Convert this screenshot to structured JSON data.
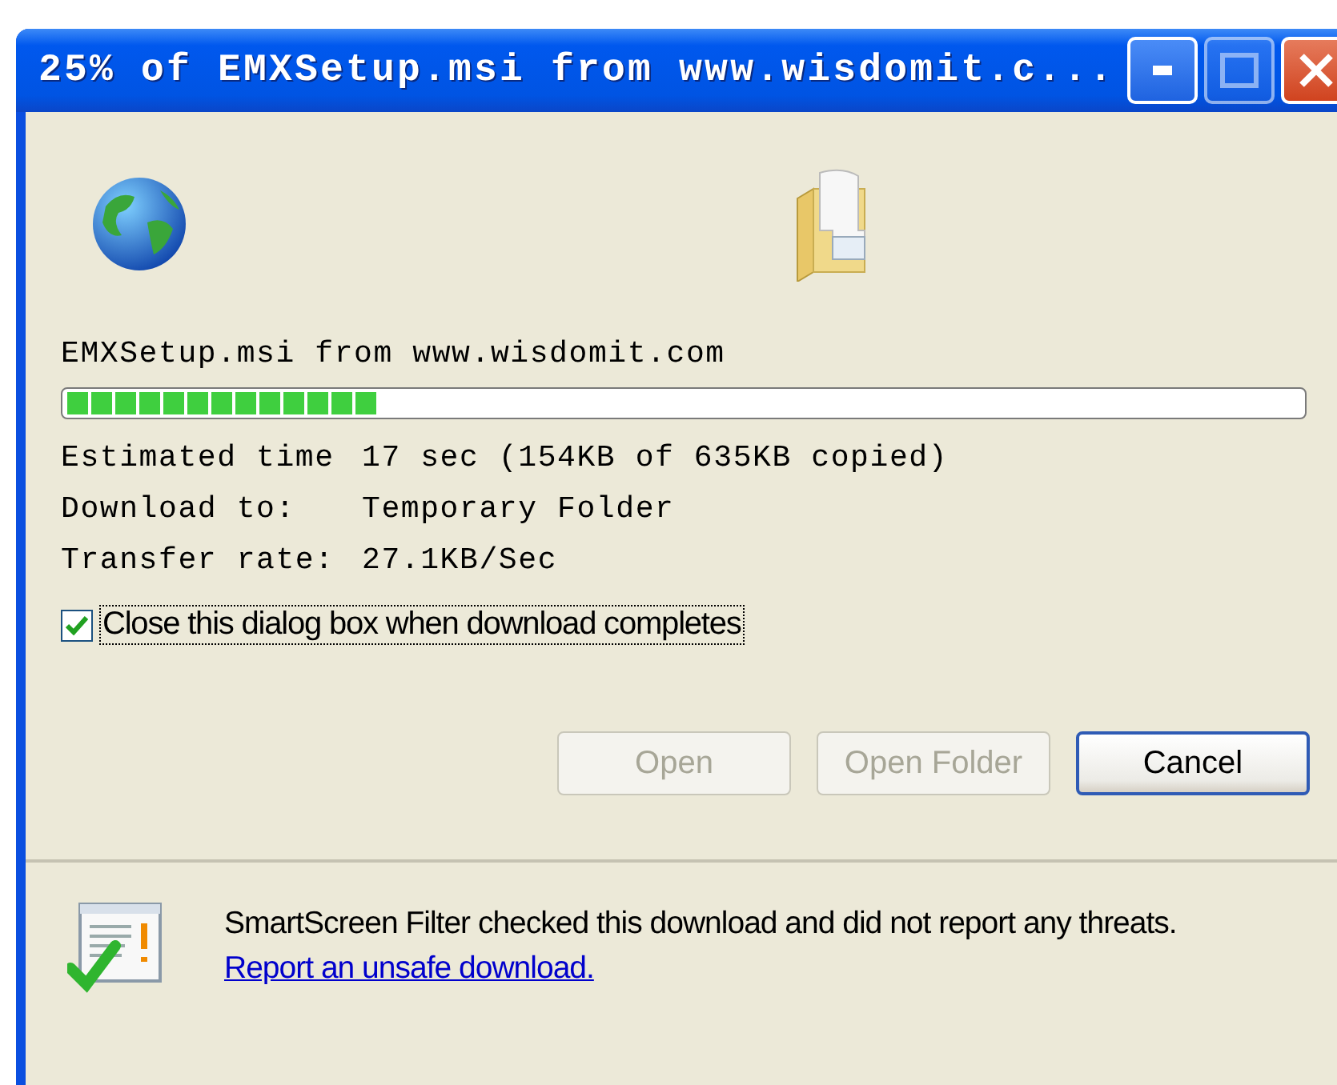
{
  "window": {
    "title": "25% of EMXSetup.msi from www.wisdomit.c...",
    "controls": [
      {
        "kind": "minimize",
        "disabled": false
      },
      {
        "kind": "maximize",
        "disabled": true
      },
      {
        "kind": "close",
        "disabled": false
      }
    ]
  },
  "file_line": "EMXSetup.msi from www.wisdomit.com",
  "progress": {
    "level": 0.25
  },
  "details": [
    {
      "label": "Estimated time",
      "value": "17 sec (154KB of 635KB copied)"
    },
    {
      "label": "Download to:",
      "value": "Temporary Folder"
    },
    {
      "label": "Transfer rate:",
      "value": "27.1KB/Sec"
    }
  ],
  "close_when_done": {
    "label": "Close this dialog box when download completes",
    "checked": true
  },
  "buttons": [
    {
      "label": "Open",
      "disabled": true,
      "default": false
    },
    {
      "label": "Open Folder",
      "disabled": true,
      "default": false
    },
    {
      "label": "Cancel",
      "disabled": false,
      "default": true
    }
  ],
  "smartscreen": {
    "text": "SmartScreen Filter checked this download and did not report any threats.",
    "link": "Report an unsafe download."
  }
}
